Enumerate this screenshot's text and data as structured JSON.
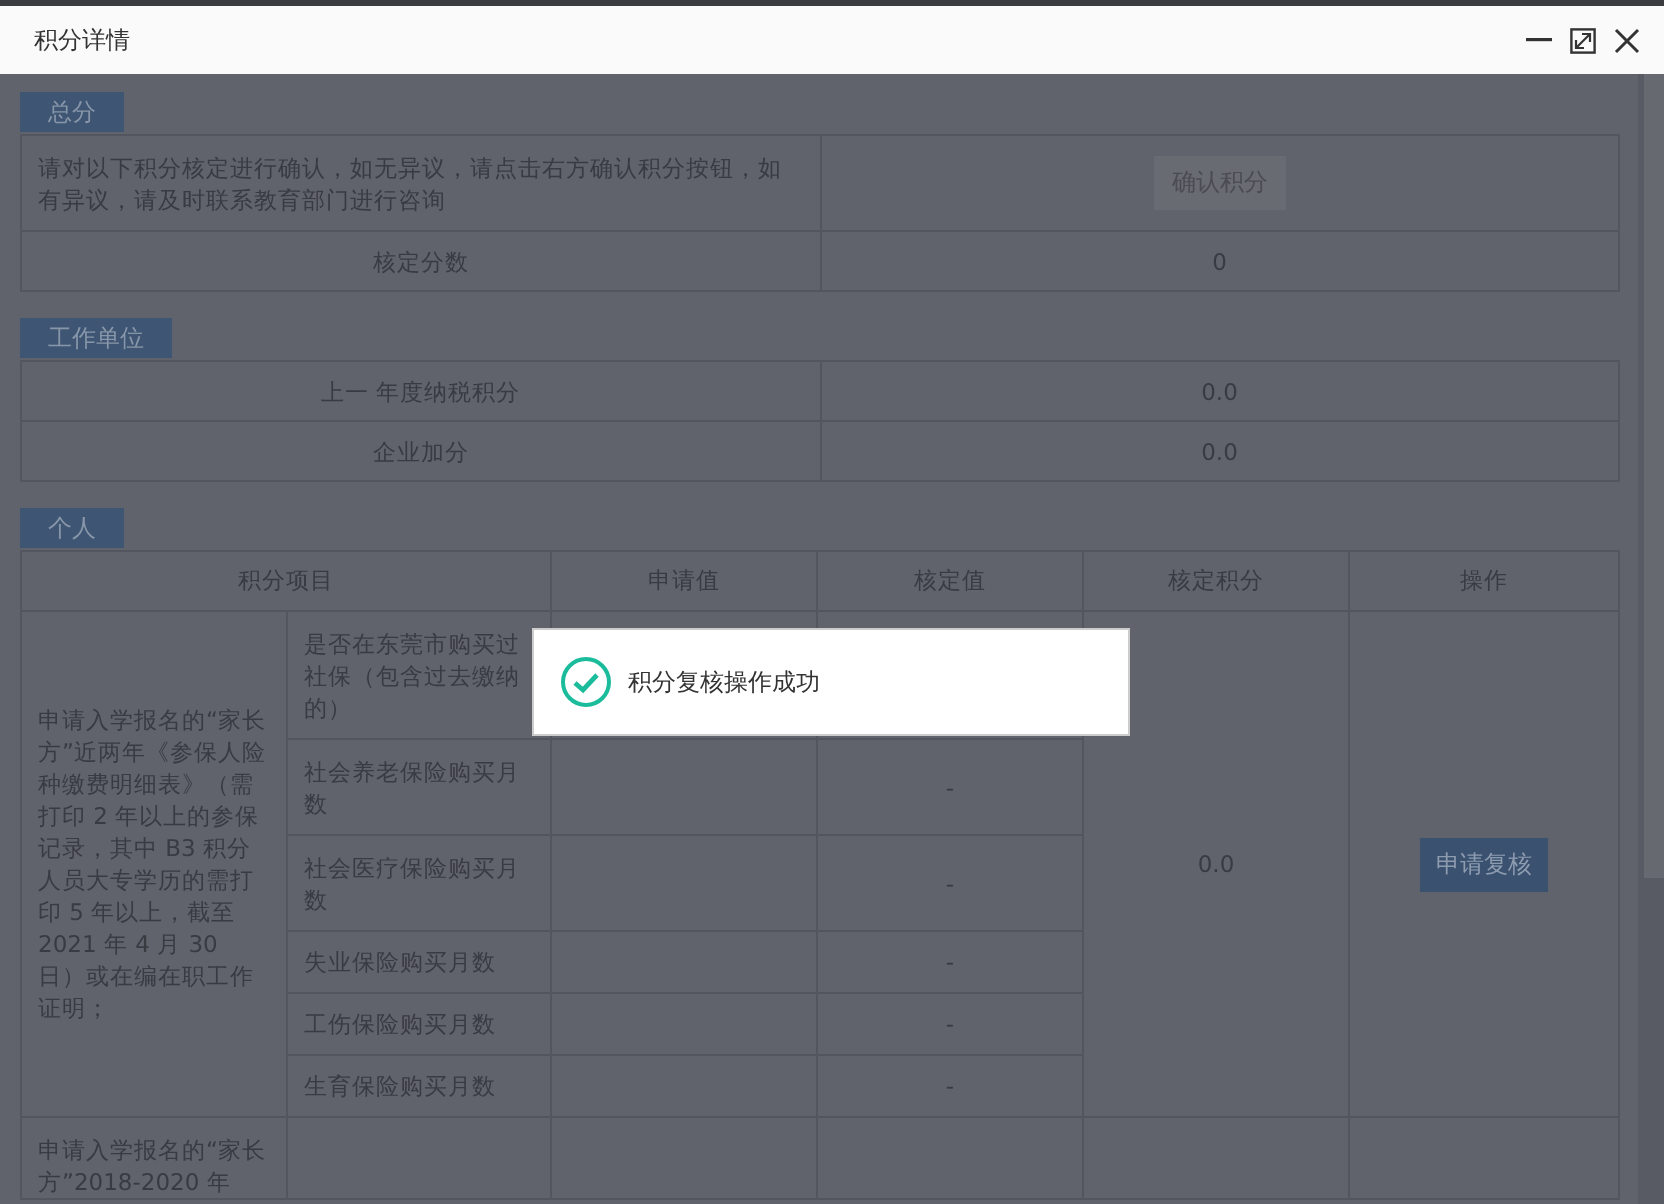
{
  "window": {
    "title": "积分详情"
  },
  "total": {
    "tab": "总分",
    "notice": "请对以下积分核定进行确认，如无异议，请点击右方确认积分按钮，如有异议，请及时联系教育部门进行咨询",
    "confirm_button": "确认积分",
    "rows": [
      {
        "label": "核定分数",
        "value": "0"
      }
    ]
  },
  "employer": {
    "tab": "工作单位",
    "rows": [
      {
        "label": "上一 年度纳税积分",
        "value": "0.0"
      },
      {
        "label": "企业加分",
        "value": "0.0"
      }
    ]
  },
  "personal": {
    "tab": "个人",
    "columns": [
      "积分项目",
      "申请值",
      "核定值",
      "核定积分",
      "操作"
    ],
    "groups": [
      {
        "item": "申请入学报名的“家长方”近两年《参保人险种缴费明细表》（需打印 2 年以上的参保记录，其中 B3 积分人员大专学历的需打印 5 年以上，截至 2021 年 4 月 30 日）或在编在职工作证明；",
        "score": "0.0",
        "action": "申请复核",
        "sub_items": [
          {
            "label": "是否在东莞市购买过社保（包含过去缴纳的）"
          },
          {
            "label": "社会养老保险购买月数",
            "verified": "-"
          },
          {
            "label": "社会医疗保险购买月数",
            "verified": "-"
          },
          {
            "label": "失业保险购买月数",
            "verified": "-"
          },
          {
            "label": "工伤保险购买月数",
            "verified": "-"
          },
          {
            "label": "生育保险购买月数",
            "verified": "-"
          }
        ]
      },
      {
        "item": "申请入学报名的“家长方”2018-2020 年"
      }
    ]
  },
  "toast": {
    "message": "积分复核操作成功"
  }
}
